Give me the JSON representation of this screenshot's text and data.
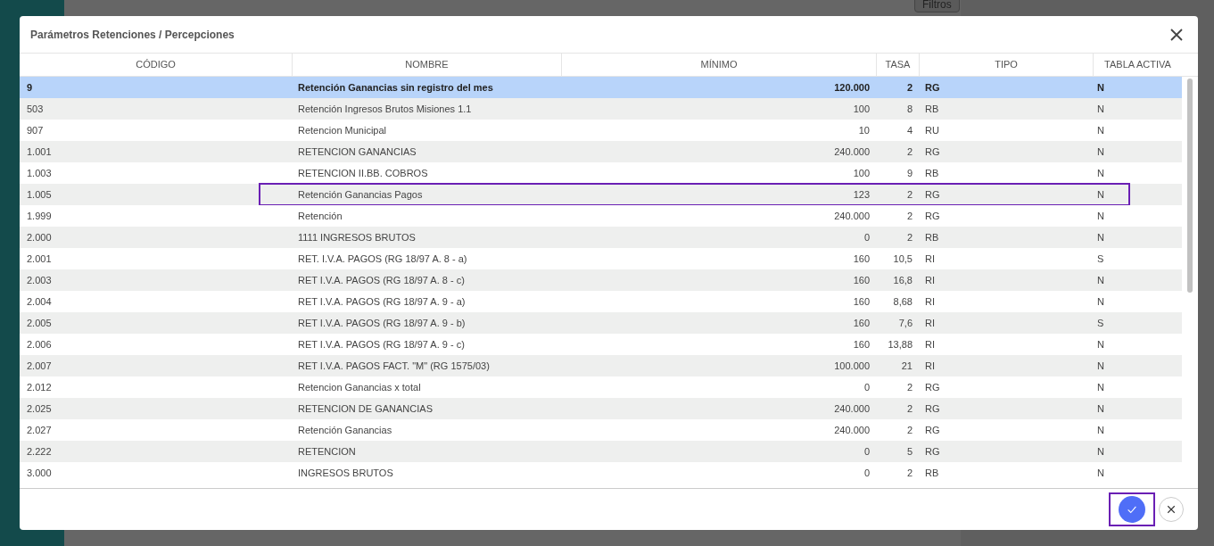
{
  "background": {
    "filter_button": "Filtros"
  },
  "dialog": {
    "title": "Parámetros Retenciones / Percepciones",
    "table": {
      "columns": [
        "CÓDIGO",
        "NOMBRE",
        "MÍNIMO",
        "TASA",
        "TIPO",
        "TABLA ACTIVA"
      ],
      "rows": [
        {
          "cells": [
            "9",
            "Retención Ganancias sin registro del mes",
            "120.000",
            "2",
            "RG",
            "N"
          ],
          "selected": true,
          "highlighted": false
        },
        {
          "cells": [
            "503",
            "Retención Ingresos Brutos Misiones 1.1",
            "100",
            "8",
            "RB",
            "N"
          ],
          "selected": false,
          "highlighted": false
        },
        {
          "cells": [
            "907",
            "Retencion Municipal",
            "10",
            "4",
            "RU",
            "N"
          ],
          "selected": false,
          "highlighted": false
        },
        {
          "cells": [
            "1.001",
            "RETENCION GANANCIAS",
            "240.000",
            "2",
            "RG",
            "N"
          ],
          "selected": false,
          "highlighted": false
        },
        {
          "cells": [
            "1.003",
            "RETENCION II.BB. COBROS",
            "100",
            "9",
            "RB",
            "N"
          ],
          "selected": false,
          "highlighted": false
        },
        {
          "cells": [
            "1.005",
            "Retención Ganancias Pagos",
            "123",
            "2",
            "RG",
            "N"
          ],
          "selected": false,
          "highlighted": true
        },
        {
          "cells": [
            "1.999",
            "Retención",
            "240.000",
            "2",
            "RG",
            "N"
          ],
          "selected": false,
          "highlighted": false
        },
        {
          "cells": [
            "2.000",
            "1111 INGRESOS BRUTOS",
            "0",
            "2",
            "RB",
            "N"
          ],
          "selected": false,
          "highlighted": false
        },
        {
          "cells": [
            "2.001",
            "RET. I.V.A. PAGOS (RG 18/97 A. 8 - a)",
            "160",
            "10,5",
            "RI",
            "S"
          ],
          "selected": false,
          "highlighted": false
        },
        {
          "cells": [
            "2.003",
            "RET I.V.A. PAGOS (RG 18/97 A. 8 - c)",
            "160",
            "16,8",
            "RI",
            "N"
          ],
          "selected": false,
          "highlighted": false
        },
        {
          "cells": [
            "2.004",
            "RET I.V.A. PAGOS (RG 18/97 A. 9 - a)",
            "160",
            "8,68",
            "RI",
            "N"
          ],
          "selected": false,
          "highlighted": false
        },
        {
          "cells": [
            "2.005",
            "RET I.V.A. PAGOS (RG 18/97 A. 9 - b)",
            "160",
            "7,6",
            "RI",
            "S"
          ],
          "selected": false,
          "highlighted": false
        },
        {
          "cells": [
            "2.006",
            "RET I.V.A. PAGOS (RG 18/97 A. 9 - c)",
            "160",
            "13,88",
            "RI",
            "N"
          ],
          "selected": false,
          "highlighted": false
        },
        {
          "cells": [
            "2.007",
            "RET I.V.A. PAGOS FACT. \"M\" (RG 1575/03)",
            "100.000",
            "21",
            "RI",
            "N"
          ],
          "selected": false,
          "highlighted": false
        },
        {
          "cells": [
            "2.012",
            "Retencion Ganancias x total",
            "0",
            "2",
            "RG",
            "N"
          ],
          "selected": false,
          "highlighted": false
        },
        {
          "cells": [
            "2.025",
            "RETENCION DE GANANCIAS",
            "240.000",
            "2",
            "RG",
            "N"
          ],
          "selected": false,
          "highlighted": false
        },
        {
          "cells": [
            "2.027",
            "Retención Ganancias",
            "240.000",
            "2",
            "RG",
            "N"
          ],
          "selected": false,
          "highlighted": false
        },
        {
          "cells": [
            "2.222",
            "RETENCION",
            "0",
            "5",
            "RG",
            "N"
          ],
          "selected": false,
          "highlighted": false
        },
        {
          "cells": [
            "3.000",
            "INGRESOS BRUTOS",
            "0",
            "2",
            "RB",
            "N"
          ],
          "selected": false,
          "highlighted": false
        }
      ]
    },
    "confirm_button": {
      "highlighted": true
    }
  }
}
